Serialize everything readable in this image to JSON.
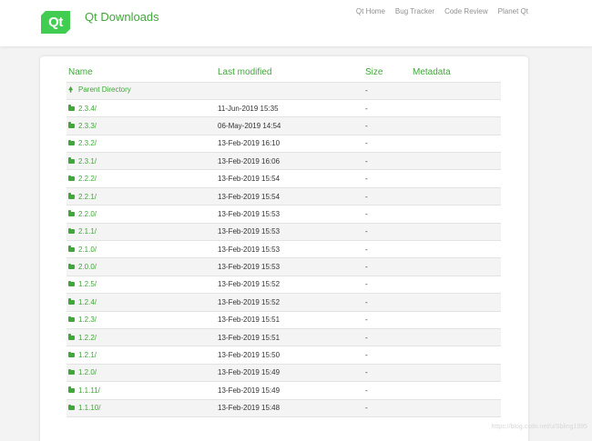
{
  "header": {
    "logo_text": "Qt",
    "site_title": "Qt Downloads",
    "nav": [
      "Qt Home",
      "Bug Tracker",
      "Code Review",
      "Planet Qt"
    ]
  },
  "table": {
    "columns": [
      "Name",
      "Last modified",
      "Size",
      "Metadata"
    ],
    "parent": {
      "name": "Parent Directory",
      "size": "-"
    },
    "rows": [
      {
        "name": "2.3.4/",
        "modified": "11-Jun-2019 15:35",
        "size": "-"
      },
      {
        "name": "2.3.3/",
        "modified": "06-May-2019 14:54",
        "size": "-"
      },
      {
        "name": "2.3.2/",
        "modified": "13-Feb-2019 16:10",
        "size": "-"
      },
      {
        "name": "2.3.1/",
        "modified": "13-Feb-2019 16:06",
        "size": "-"
      },
      {
        "name": "2.2.2/",
        "modified": "13-Feb-2019 15:54",
        "size": "-"
      },
      {
        "name": "2.2.1/",
        "modified": "13-Feb-2019 15:54",
        "size": "-"
      },
      {
        "name": "2.2.0/",
        "modified": "13-Feb-2019 15:53",
        "size": "-"
      },
      {
        "name": "2.1.1/",
        "modified": "13-Feb-2019 15:53",
        "size": "-"
      },
      {
        "name": "2.1.0/",
        "modified": "13-Feb-2019 15:53",
        "size": "-"
      },
      {
        "name": "2.0.0/",
        "modified": "13-Feb-2019 15:53",
        "size": "-"
      },
      {
        "name": "1.2.5/",
        "modified": "13-Feb-2019 15:52",
        "size": "-"
      },
      {
        "name": "1.2.4/",
        "modified": "13-Feb-2019 15:52",
        "size": "-"
      },
      {
        "name": "1.2.3/",
        "modified": "13-Feb-2019 15:51",
        "size": "-"
      },
      {
        "name": "1.2.2/",
        "modified": "13-Feb-2019 15:51",
        "size": "-"
      },
      {
        "name": "1.2.1/",
        "modified": "13-Feb-2019 15:50",
        "size": "-"
      },
      {
        "name": "1.2.0/",
        "modified": "13-Feb-2019 15:49",
        "size": "-"
      },
      {
        "name": "1.1.11/",
        "modified": "13-Feb-2019 15:49",
        "size": "-"
      },
      {
        "name": "1.1.10/",
        "modified": "13-Feb-2019 15:48",
        "size": "-"
      }
    ]
  },
  "watermark": "https://blog.csdn.net/u/Sbling1995",
  "colors": {
    "brand": "#41cd52",
    "link": "#41a73a",
    "stripe": "#f4f4f4",
    "background": "#f3f3f3"
  }
}
